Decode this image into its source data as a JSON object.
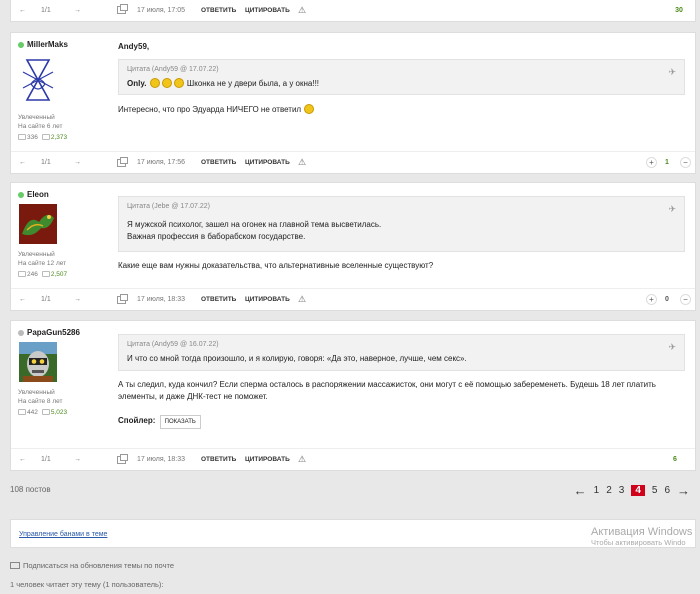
{
  "top_footer": {
    "prev": "←",
    "page": "1/1",
    "next": "→",
    "date": "17 июля, 17:05",
    "reply": "ОТВЕТИТЬ",
    "quote": "ЦИТИРОВАТЬ",
    "score": "30"
  },
  "posts": [
    {
      "author": "MillerMaks",
      "online": true,
      "role": "Увлеченный",
      "tenure": "На сайте 6 лет",
      "comments": "336",
      "likes": "2,373",
      "greeting": "Andy59,",
      "quote_head": "Цитата (Andy59 @ 17.07.22)",
      "quote_lead": "Only.",
      "quote_text": "Шконка не у двери была, а у окна!!!",
      "text": "Интересно, что про Эдуарда НИЧЕГО не ответил",
      "footer": {
        "prev": "←",
        "page": "1/1",
        "next": "→",
        "date": "17 июля, 17:56",
        "reply": "ОТВЕТИТЬ",
        "quote": "ЦИТИРОВАТЬ",
        "plus": "+",
        "score": "1",
        "minus": "−"
      }
    },
    {
      "author": "Eleon",
      "online": true,
      "role": "Увлеченный",
      "tenure": "На сайте 12 лет",
      "comments": "246",
      "likes": "2,507",
      "quote_head": "Цитата (Jebe @ 17.07.22)",
      "quote_line1": "Я мужской психолог, зашел на огонек на главной тема высветилась.",
      "quote_line2": "Важная профессия в баборабском государстве.",
      "text": "Какие еще вам нужны доказательства, что альтернативные вселенные существуют?",
      "footer": {
        "prev": "←",
        "page": "1/1",
        "next": "→",
        "date": "17 июля, 18:33",
        "reply": "ОТВЕТИТЬ",
        "quote": "ЦИТИРОВАТЬ",
        "plus": "+",
        "score": "0",
        "minus": "−"
      }
    },
    {
      "author": "PapaGun5286",
      "online": false,
      "role": "Увлеченный",
      "tenure": "На сайте 8 лет",
      "comments": "442",
      "likes": "5,023",
      "quote_head": "Цитата (Andy59 @ 16.07.22)",
      "quote_text": "И что со мной тогда произошло, и я колирую, говоря: «Да это, наверное, лучше, чем секс».",
      "text": "А ты следил, куда кончил? Если сперма осталось в распоряжении массажисток, они могут с её помощью забеременеть. Будешь 18 лет платить элементы, и даже ДНК-тест не поможет.",
      "spoiler_label": "Спойлер:",
      "spoiler_button": "ПОКАЗАТЬ",
      "footer": {
        "prev": "←",
        "page": "1/1",
        "next": "→",
        "date": "17 июля, 18:33",
        "reply": "ОТВЕТИТЬ",
        "quote": "ЦИТИРОВАТЬ",
        "score": "6"
      }
    }
  ],
  "post_count": "108 постов",
  "pagination": {
    "prev": "←",
    "pages": [
      "1",
      "2",
      "3",
      "4",
      "5",
      "6"
    ],
    "current": "4",
    "next": "→"
  },
  "ban_link": "Управление банами в теме",
  "windows_watermark": {
    "line1": "Активация Windows",
    "line2": "Чтобы активировать Windo"
  },
  "subscribe": "Подписаться на обновления темы по почте",
  "readers": "1 человек читает эту тему (1 пользователь):"
}
